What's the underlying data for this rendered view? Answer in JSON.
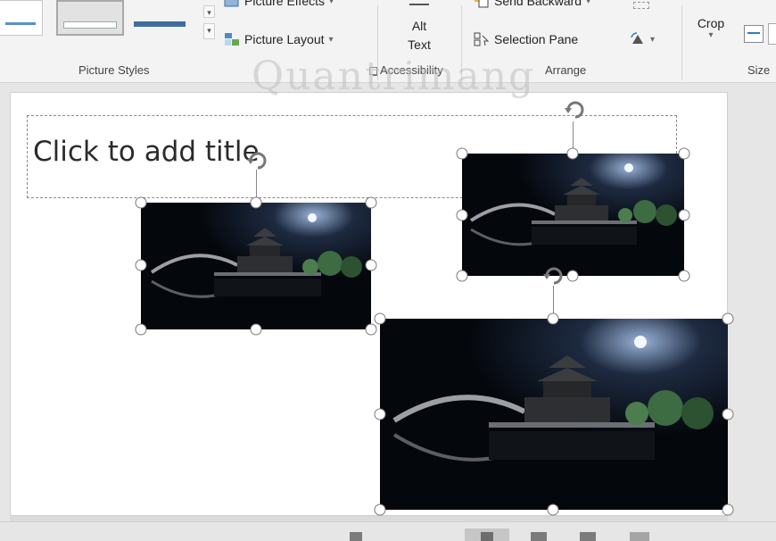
{
  "ribbon": {
    "picture_effects_label": "Picture Effects",
    "picture_layout_label": "Picture Layout",
    "alt_text_line1": "Alt",
    "alt_text_line2": "Text",
    "send_backward_label": "Send Backward",
    "selection_pane_label": "Selection Pane",
    "crop_label": "Crop",
    "dropdown_glyph": "▾",
    "groups": {
      "picture_styles": "Picture Styles",
      "accessibility": "Accessibility",
      "arrange": "Arrange",
      "size": "Size"
    }
  },
  "slide": {
    "title_placeholder": "Click to add title"
  },
  "watermark": "Quantrimang",
  "colors": {
    "ribbon_bg": "#f3f3f3",
    "workspace_bg": "#e6e6e6",
    "slide_bg": "#ffffff",
    "picture_night_sky": "#050a12",
    "moon_glow": "#cfe3ff"
  }
}
